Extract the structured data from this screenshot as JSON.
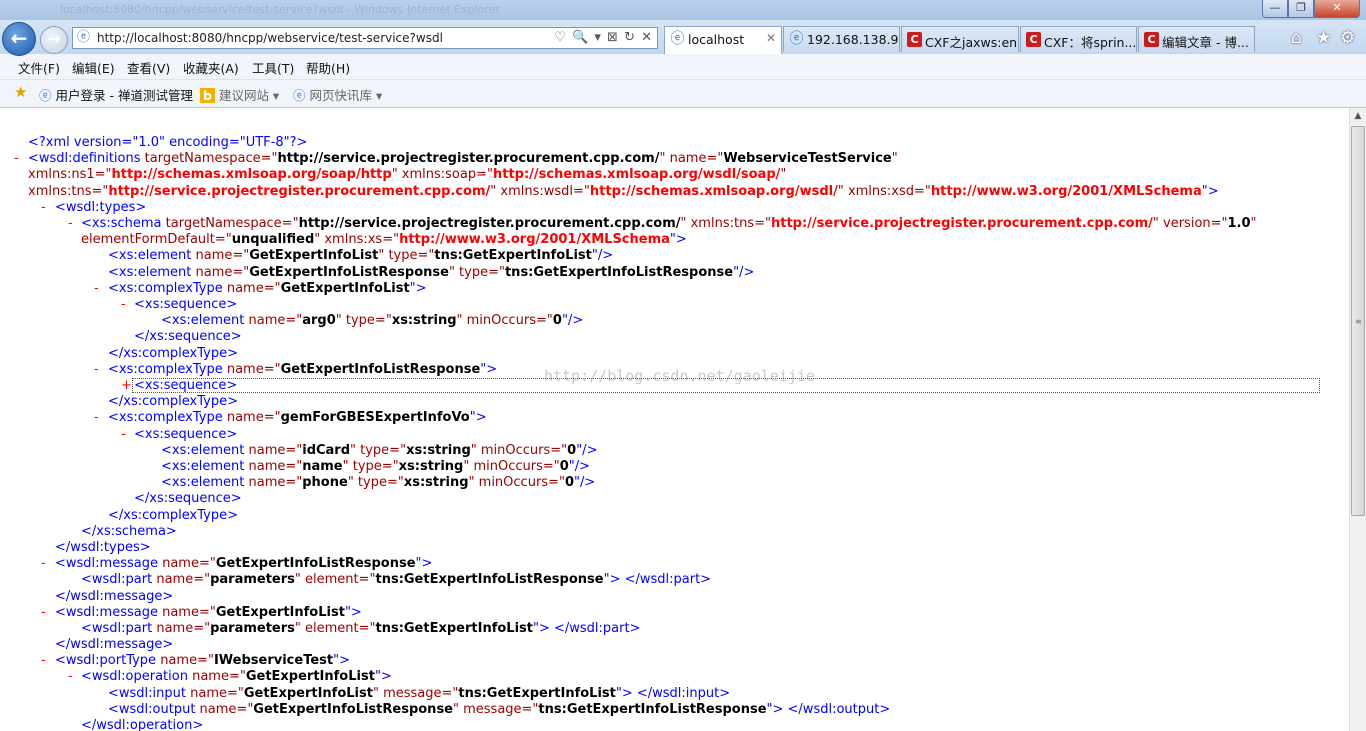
{
  "window": {
    "title": "localhost:8080/hncpp/webservice/test-service?wsdl - Windows Internet Explorer",
    "minimize": "—",
    "maximize": "❐",
    "close": "✕"
  },
  "nav": {
    "back_icon": "arrow-left-icon",
    "forward_icon": "arrow-right-icon",
    "address": "http://localhost:8080/hncpp/webservice/test-service?wsdl",
    "address_icons": "♡ 🔍 ▾ ⊠ ↻ ✕"
  },
  "tabs": [
    {
      "label": "localhost",
      "icon": "ie-icon",
      "close": "✕",
      "active": true
    },
    {
      "label": "192.168.138.96",
      "icon": "ie-icon",
      "active": false
    },
    {
      "label": "CXF之jaxws:en...",
      "icon": "csdn-icon",
      "active": false
    },
    {
      "label": "CXF：将sprin...",
      "icon": "csdn-icon",
      "active": false
    },
    {
      "label": "编辑文章 - 博...",
      "icon": "csdn-icon",
      "active": false
    }
  ],
  "toolbar_icons": {
    "home": "⌂",
    "favorites": "★",
    "tools": "⚙"
  },
  "menu": [
    "文件(F)",
    "编辑(E)",
    "查看(V)",
    "收藏夹(A)",
    "工具(T)",
    "帮助(H)"
  ],
  "favorites_bar": [
    {
      "label": "用户登录 - 禅道测试管理",
      "icon": "ie-icon"
    },
    {
      "label": "建议网站 ▾",
      "icon": "bing-icon"
    },
    {
      "label": "网页快讯库 ▾",
      "icon": "webslice-icon"
    }
  ],
  "watermark": "http://blog.csdn.net/gaoleijie",
  "xml": {
    "l01": "<?xml version=\"1.0\" encoding=\"UTF-8\"?>",
    "l02_tag": "<wsdl:definitions",
    "l02_a1": " targetNamespace=\"",
    "l02_v1": "http://service.projectregister.procurement.cpp.com/",
    "l02_a2": "\" name=\"",
    "l02_v2": "WebserviceTestService",
    "l02_a3": "\"",
    "l03_a1": "xmlns:ns1=\"",
    "l03_v1": "http://schemas.xmlsoap.org/soap/http",
    "l03_a2": "\" xmlns:soap=\"",
    "l03_v2": "http://schemas.xmlsoap.org/wsdl/soap/",
    "l03_a3": "\"",
    "l04_a1": "xmlns:tns=\"",
    "l04_v1": "http://service.projectregister.procurement.cpp.com/",
    "l04_a2": "\" xmlns:wsdl=\"",
    "l04_v2": "http://schemas.xmlsoap.org/wsdl/",
    "l04_a3": "\" xmlns:xsd=\"",
    "l04_v3": "http://www.w3.org/2001/XMLSchema",
    "l04_a4": "\">",
    "l05": "<wsdl:types>",
    "l06_tag": "<xs:schema",
    "l06_a1": " targetNamespace=\"",
    "l06_v1": "http://service.projectregister.procurement.cpp.com/",
    "l06_a2": "\" xmlns:tns=\"",
    "l06_v2": "http://service.projectregister.procurement.cpp.com/",
    "l06_a3": "\" version=\"",
    "l06_v3": "1.0",
    "l06_a4": "\"",
    "l07_a1": "elementFormDefault=\"",
    "l07_v1": "unqualified",
    "l07_a2": "\" xmlns:xs=\"",
    "l07_v2": "http://www.w3.org/2001/XMLSchema",
    "l07_a3": "\">",
    "l08_tag": "<xs:element",
    "l08_a1": " name=\"",
    "l08_v1": "GetExpertInfoList",
    "l08_a2": "\" type=\"",
    "l08_v2": "tns:GetExpertInfoList",
    "l08_a3": "\"/>",
    "l09_tag": "<xs:element",
    "l09_a1": " name=\"",
    "l09_v1": "GetExpertInfoListResponse",
    "l09_a2": "\" type=\"",
    "l09_v2": "tns:GetExpertInfoListResponse",
    "l09_a3": "\"/>",
    "l10_tag": "<xs:complexType",
    "l10_a1": " name=\"",
    "l10_v1": "GetExpertInfoList",
    "l10_a2": "\">",
    "l11": "<xs:sequence>",
    "l12_tag": "<xs:element",
    "l12_a1": " name=\"",
    "l12_v1": "arg0",
    "l12_a2": "\" type=\"",
    "l12_v2": "xs:string",
    "l12_a3": "\" minOccurs=\"",
    "l12_v3": "0",
    "l12_a4": "\"/>",
    "l13": "</xs:sequence>",
    "l14": "</xs:complexType>",
    "l15_tag": "<xs:complexType",
    "l15_a1": " name=\"",
    "l15_v1": "GetExpertInfoListResponse",
    "l15_a2": "\">",
    "l16": "<xs:sequence>",
    "l17": "</xs:complexType>",
    "l18_tag": "<xs:complexType",
    "l18_a1": " name=\"",
    "l18_v1": "gemForGBESExpertInfoVo",
    "l18_a2": "\">",
    "l19": "<xs:sequence>",
    "l20_tag": "<xs:element",
    "l20_a1": " name=\"",
    "l20_v1": "idCard",
    "l20_a2": "\" type=\"",
    "l20_v2": "xs:string",
    "l20_a3": "\" minOccurs=\"",
    "l20_v3": "0",
    "l20_a4": "\"/>",
    "l21_tag": "<xs:element",
    "l21_a1": " name=\"",
    "l21_v1": "name",
    "l21_a2": "\" type=\"",
    "l21_v2": "xs:string",
    "l21_a3": "\" minOccurs=\"",
    "l21_v3": "0",
    "l21_a4": "\"/>",
    "l22_tag": "<xs:element",
    "l22_a1": " name=\"",
    "l22_v1": "phone",
    "l22_a2": "\" type=\"",
    "l22_v2": "xs:string",
    "l22_a3": "\" minOccurs=\"",
    "l22_v3": "0",
    "l22_a4": "\"/>",
    "l23": "</xs:sequence>",
    "l24": "</xs:complexType>",
    "l25": "</xs:schema>",
    "l26": "</wsdl:types>",
    "l27_tag": "<wsdl:message",
    "l27_a1": " name=\"",
    "l27_v1": "GetExpertInfoListResponse",
    "l27_a2": "\">",
    "l28_tag": "<wsdl:part",
    "l28_a1": " name=\"",
    "l28_v1": "parameters",
    "l28_a2": "\" element=\"",
    "l28_v2": "tns:GetExpertInfoListResponse",
    "l28_a3": "\"> </wsdl:part>",
    "l29": "</wsdl:message>",
    "l30_tag": "<wsdl:message",
    "l30_a1": " name=\"",
    "l30_v1": "GetExpertInfoList",
    "l30_a2": "\">",
    "l31_tag": "<wsdl:part",
    "l31_a1": " name=\"",
    "l31_v1": "parameters",
    "l31_a2": "\" element=\"",
    "l31_v2": "tns:GetExpertInfoList",
    "l31_a3": "\"> </wsdl:part>",
    "l32": "</wsdl:message>",
    "l33_tag": "<wsdl:portType",
    "l33_a1": " name=\"",
    "l33_v1": "IWebserviceTest",
    "l33_a2": "\">",
    "l34_tag": "<wsdl:operation",
    "l34_a1": " name=\"",
    "l34_v1": "GetExpertInfoList",
    "l34_a2": "\">",
    "l35_tag": "<wsdl:input",
    "l35_a1": " name=\"",
    "l35_v1": "GetExpertInfoList",
    "l35_a2": "\" message=\"",
    "l35_v2": "tns:GetExpertInfoList",
    "l35_a3": "\"> </wsdl:input>",
    "l36_tag": "<wsdl:output",
    "l36_a1": " name=\"",
    "l36_v1": "GetExpertInfoListResponse",
    "l36_a2": "\" message=\"",
    "l36_v2": "tns:GetExpertInfoListResponse",
    "l36_a3": "\"> </wsdl:output>",
    "l37": "</wsdl:operation>"
  },
  "markers": {
    "collapse": "-",
    "expand": "+"
  },
  "colors": {
    "tag": "#990000",
    "bracket": "#0000ff",
    "namespace": "#ff0000",
    "marker": "#ff0000"
  }
}
